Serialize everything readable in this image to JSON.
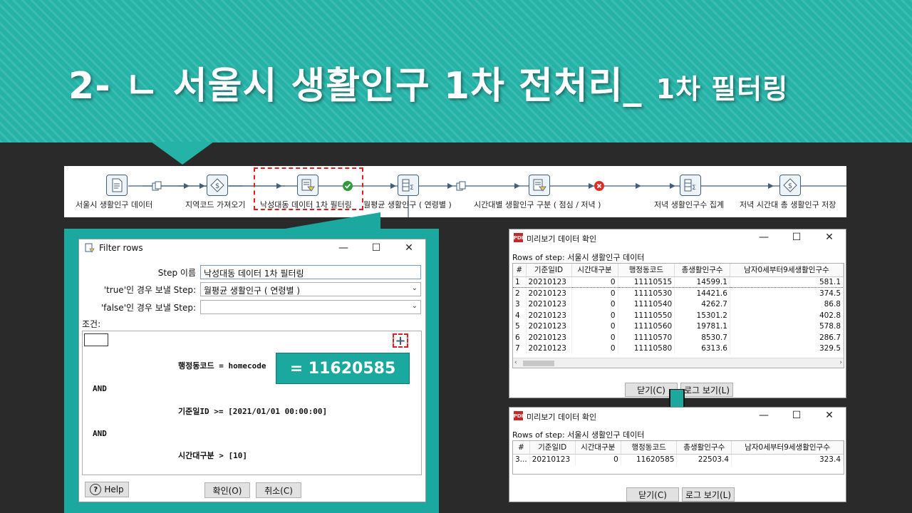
{
  "slide": {
    "title_main": "2- ㄴ 서울시 생활인구 1차 전처리_",
    "title_sub": "1차 필터링"
  },
  "flow": {
    "steps": [
      {
        "label": "서울시 생활인구 데이터",
        "icon": "text-file-input-icon"
      },
      {
        "label": "지역코드 가져오기",
        "icon": "database-lookup-icon"
      },
      {
        "label": "낙성대동 데이터 1차 필터링",
        "icon": "filter-rows-icon"
      },
      {
        "label": "월평균 생활인구 ( 연령별 )",
        "icon": "group-by-icon"
      },
      {
        "label": "시간대별 생활인구 구분 ( 점심 / 저녁 )",
        "icon": "filter-rows-icon"
      },
      {
        "label": "저녁 생활인구수 집계",
        "icon": "group-by-icon"
      },
      {
        "label": "저녁 시간대 총 생활인구 저장",
        "icon": "table-output-icon"
      }
    ]
  },
  "filter_dialog": {
    "title": "Filter rows",
    "step_name_label": "Step 이름",
    "step_name_value": "낙성대동 데이터 1차 필터링",
    "true_label": "'true'인 경우 보낼 Step:",
    "true_value": "월평균 생활인구 ( 연령별 )",
    "false_label": "'false'인 경우 보낼 Step:",
    "false_value": "",
    "conditions_label": "조건:",
    "plus_symbol": "+",
    "cond1": "행정동코드 = homecode",
    "and1": "AND",
    "cond2": "기준일ID >= [2021/01/01 00:00:00]",
    "and2": "AND",
    "cond3": "시간대구분 > [10]",
    "callout": "= 11620585",
    "help_label": "Help",
    "ok_label": "확인(O)",
    "cancel_label": "취소(C)"
  },
  "preview_top": {
    "title": "미리보기 데이터 확인",
    "rows_label": "Rows of step: 서울시 생활인구 데이터",
    "columns": [
      "#",
      "기준일ID",
      "시간대구분",
      "행정동코드",
      "총생활인구수",
      "남자0세부터9세생활인구수"
    ],
    "rows": [
      [
        "1",
        "20210123",
        "0",
        "11110515",
        "14599.1",
        "581.1"
      ],
      [
        "2",
        "20210123",
        "0",
        "11110530",
        "14421.6",
        "374.5"
      ],
      [
        "3",
        "20210123",
        "0",
        "11110540",
        "4262.7",
        "86.8"
      ],
      [
        "4",
        "20210123",
        "0",
        "11110550",
        "15301.2",
        "402.8"
      ],
      [
        "5",
        "20210123",
        "0",
        "11110560",
        "19781.1",
        "578.8"
      ],
      [
        "6",
        "20210123",
        "0",
        "11110570",
        "8530.7",
        "286.7"
      ],
      [
        "7",
        "20210123",
        "0",
        "11110580",
        "6313.6",
        "329.5"
      ]
    ],
    "close_label": "닫기(C)",
    "log_label": "로그 보기(L)"
  },
  "preview_bottom": {
    "title": "미리보기 데이터 확인",
    "rows_label": "Rows of step: 서울시 생활인구 데이터",
    "columns": [
      "#",
      "기준일ID",
      "시간대구분",
      "행정동코드",
      "총생활인구수",
      "남자0세부터9세생활인구수"
    ],
    "rows": [
      [
        "3...",
        "20210123",
        "0",
        "11620585",
        "22503.4",
        "323.4"
      ]
    ],
    "close_label": "닫기(C)",
    "log_label": "로그 보기(L)"
  },
  "colors": {
    "teal": "#26b3a7",
    "highlight_red": "#e02020",
    "success_green": "#2e9b3c",
    "error_red": "#d93025"
  }
}
